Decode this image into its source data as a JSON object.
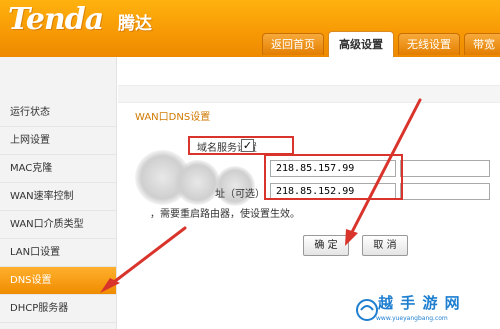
{
  "header": {
    "logo": "Tenda",
    "logo_sub": "腾达",
    "tabs": [
      "返回首页",
      "高级设置",
      "无线设置",
      "带宽"
    ]
  },
  "menu": {
    "items": [
      "运行状态",
      "上网设置",
      "MAC克隆",
      "WAN速率控制",
      "WAN口介质类型",
      "LAN口设置",
      "DNS设置",
      "DHCP服务器"
    ],
    "active_index": 6
  },
  "form": {
    "section_title": "WAN口DNS设置",
    "enable_label": "域名服务设置",
    "enable_checked_glyph": "✓",
    "dns_label_suffix": "址（可选）",
    "primary_dns": "218.85.157.99",
    "secondary_dns": "218.85.152.99",
    "note": "，需要重启路由器，使设置生效。",
    "ok_label": "确 定",
    "cancel_label": "取 消"
  },
  "watermark": {
    "title": "越 手 游 网",
    "url": "www.yueyangbang.com"
  },
  "colors": {
    "header_orange": "#f79a05",
    "annotation_red": "#d9342b",
    "title_orange": "#d07a00"
  }
}
